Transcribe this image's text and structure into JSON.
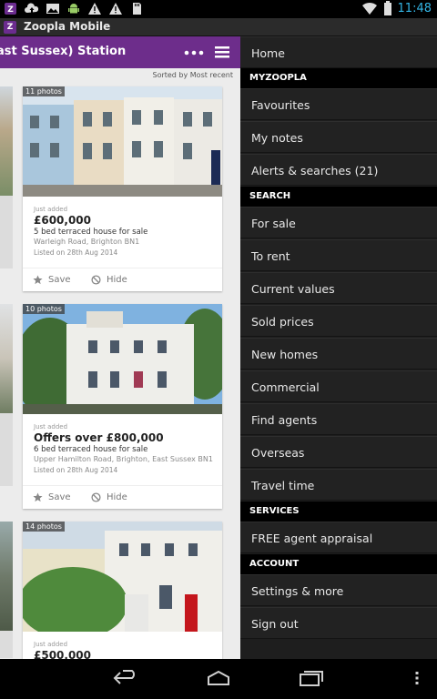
{
  "status_bar": {
    "time": "11:48",
    "icons": [
      "zoopla-notification-icon",
      "cloud-upload-icon",
      "image-icon",
      "android-icon",
      "warning-icon",
      "warning-icon",
      "sd-card-icon"
    ],
    "right_icons": [
      "wifi-icon",
      "battery-icon"
    ]
  },
  "title_bar": {
    "app_icon_letter": "Z",
    "title": "Zoopla Mobile"
  },
  "action_bar": {
    "title": "ast Sussex) Station",
    "overflow_icon": "more-dots-icon",
    "menu_icon": "hamburger-menu-icon",
    "color": "#6d2d8b"
  },
  "sort_label": "Sorted by Most recent",
  "listings": [
    {
      "photo_count": "11 photos",
      "tag": "Just added",
      "price": "£600,000",
      "description": "5 bed terraced house for sale",
      "address": "Warleigh Road, Brighton BN1",
      "listed": "Listed on 28th Aug 2014",
      "save_label": "Save",
      "hide_label": "Hide"
    },
    {
      "photo_count": "10 photos",
      "tag": "Just added",
      "price": "Offers over £800,000",
      "description": "6 bed terraced house for sale",
      "address": "Upper Hamilton Road, Brighton, East Sussex BN1",
      "listed": "Listed on 28th Aug 2014",
      "save_label": "Save",
      "hide_label": "Hide"
    },
    {
      "photo_count": "14 photos",
      "tag": "Just added",
      "price": "£500,000"
    }
  ],
  "drawer": {
    "home": "Home",
    "sections": {
      "myzoopla": "MYZOOPLA",
      "search": "SEARCH",
      "services": "SERVICES",
      "account": "ACCOUNT"
    },
    "myzoopla_items": [
      "Favourites",
      "My notes",
      "Alerts & searches (21)"
    ],
    "search_items": [
      "For sale",
      "To rent",
      "Current values",
      "Sold prices",
      "New homes",
      "Commercial",
      "Find agents",
      "Overseas",
      "Travel time"
    ],
    "services_items": [
      "FREE agent appraisal"
    ],
    "account_items": [
      "Settings & more",
      "Sign out"
    ]
  },
  "nav_bar": {
    "icons": [
      "back-icon",
      "home-icon",
      "recent-apps-icon",
      "overflow-menu-icon"
    ]
  },
  "colors": {
    "brand_purple": "#6d2d8b",
    "time_blue": "#33b5e5",
    "drawer_bg": "#1e1e1e"
  }
}
